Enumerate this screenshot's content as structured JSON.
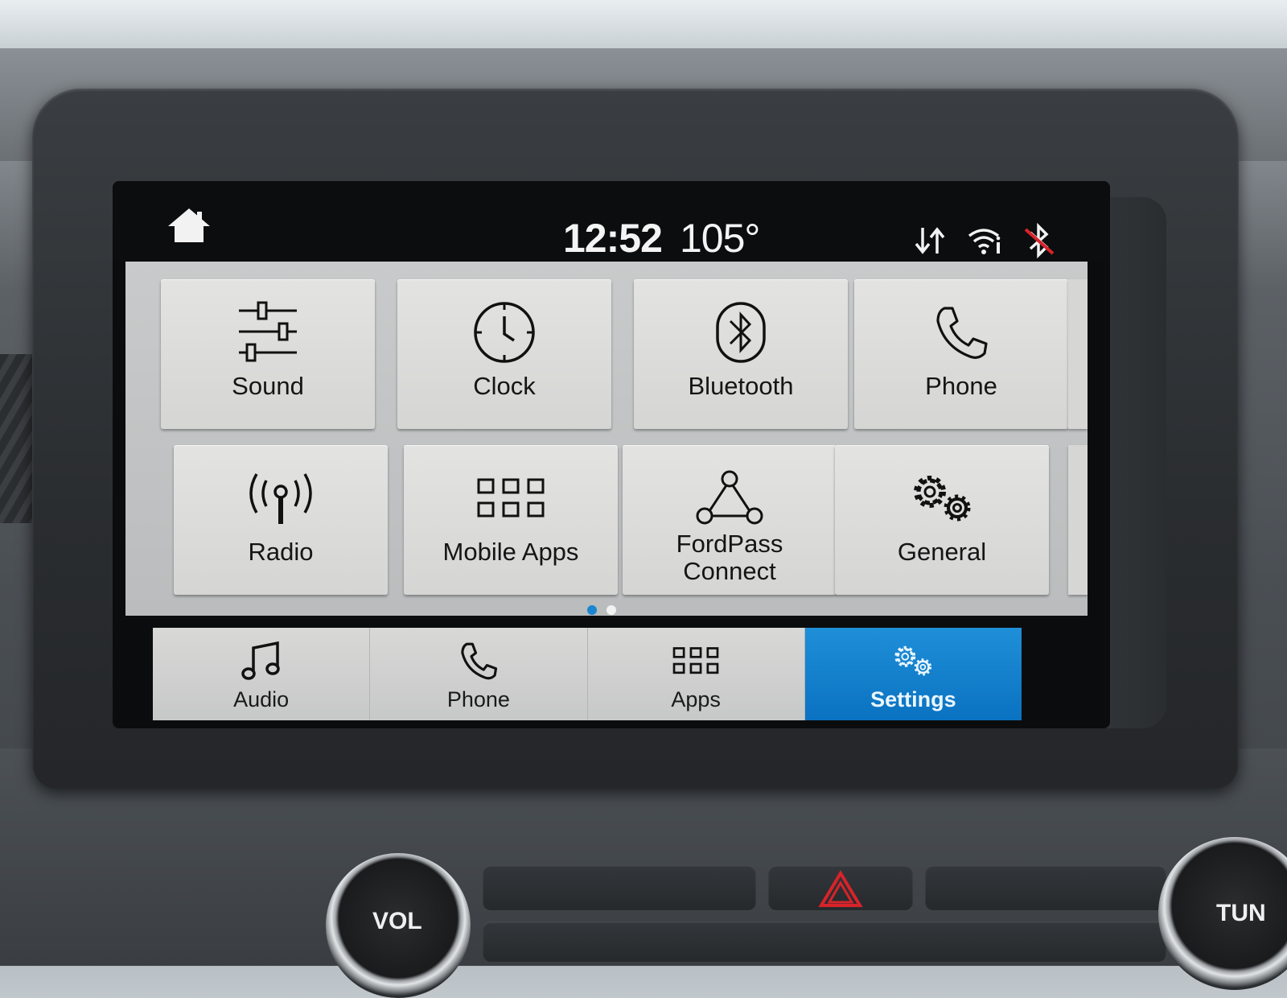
{
  "status_bar": {
    "time": "12:52",
    "temperature": "105°",
    "icons": [
      "home-icon",
      "data-transfer-icon",
      "wifi-info-icon",
      "bluetooth-disabled-icon"
    ]
  },
  "settings_grid": {
    "tiles": [
      {
        "label": "Sound",
        "icon": "sliders-icon"
      },
      {
        "label": "Clock",
        "icon": "clock-icon"
      },
      {
        "label": "Bluetooth",
        "icon": "bluetooth-icon"
      },
      {
        "label": "Phone",
        "icon": "phone-icon"
      },
      {
        "label": "Radio",
        "icon": "antenna-icon"
      },
      {
        "label": "Mobile Apps",
        "icon": "app-grid-icon"
      },
      {
        "label": "FordPass Connect",
        "line1": "FordPass",
        "line2": "Connect",
        "icon": "network-triangle-icon"
      },
      {
        "label": "General",
        "icon": "gears-icon"
      }
    ],
    "page_indicator": {
      "pages": 2,
      "current": 1
    }
  },
  "bottom_nav": {
    "items": [
      {
        "label": "Audio",
        "icon": "music-note-icon"
      },
      {
        "label": "Phone",
        "icon": "phone-icon"
      },
      {
        "label": "Apps",
        "icon": "app-grid-icon"
      },
      {
        "label": "Settings",
        "icon": "gears-icon",
        "active": true
      }
    ]
  },
  "physical_controls": {
    "vol_label": "VOL",
    "tune_label": "TUN"
  },
  "colors": {
    "accent": "#0a72c1",
    "page_dot_active": "#1a86d1",
    "page_dot_inactive": "#f2f2f2",
    "hazard": "#d8232a"
  }
}
